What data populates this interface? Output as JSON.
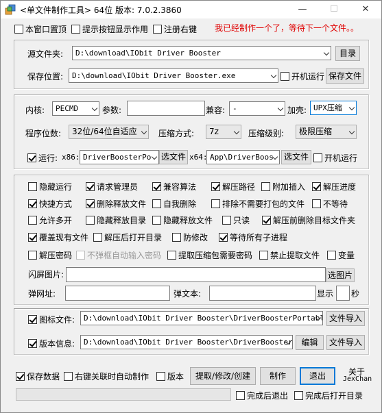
{
  "window": {
    "title": "<单文件制作工具> 64位 版本: 7.0.2.3860",
    "minimize": "—",
    "maximize": "☐",
    "close": "✕"
  },
  "top_options": {
    "pin_top": "本窗口置顶",
    "show_hints": "提示按钮显示作用",
    "register_context": "注册右键",
    "status": "我已经制作一个了，等待下一个文件。。"
  },
  "source": {
    "source_label": "源文件夹:",
    "source_value": "D:\\download\\IObit Driver Booster",
    "dir_button": "目录",
    "save_label": "保存位置:",
    "save_value": "D:\\download\\IObit Driver Booster.exe",
    "autorun_label": "开机运行",
    "save_file_button": "保存文件"
  },
  "engine": {
    "kernel_label": "内核:",
    "kernel_value": "PECMD",
    "param_label": "参数:",
    "param_value": "",
    "compat_label": "兼容:",
    "compat_value": "-",
    "shell_label": "加壳:",
    "shell_value": "UPX压缩",
    "bits_label": "程序位数:",
    "bits_value": "32位/64位自适应",
    "method_label": "压缩方式:",
    "method_value": "7z",
    "level_label": "压缩级别:",
    "level_value": "极限压缩",
    "run_label": "运行:",
    "x86_label": "x86:",
    "x86_value": "DriverBoosterPo",
    "x86_button": "选文件",
    "x64_label": "x64:",
    "x64_value": "App\\DriverBoos",
    "x64_button": "选文件",
    "run_autostart": "开机运行"
  },
  "options": {
    "row1": [
      "隐藏运行",
      "请求管理员",
      "兼容算法",
      "解压路径",
      "附加插入",
      "解压进度"
    ],
    "row2": [
      "快捷方式",
      "删除释放文件",
      "自我删除",
      "排除不需要打包的文件",
      "不等待"
    ],
    "row3": [
      "允许多开",
      "隐藏释放目录",
      "隐藏释放文件",
      "只读",
      "解压前删除目标文件夹"
    ],
    "row4": [
      "覆盖现有文件",
      "解压后打开目录",
      "防修改",
      "等待所有子进程"
    ],
    "row5": [
      "解压密码",
      "不弹框自动输入密码",
      "提取压缩包需要密码",
      "禁止提取文件",
      "变量"
    ],
    "splash_label": "闪屏图片:",
    "splash_value": "",
    "splash_button": "选图片",
    "url_label": "弹网址:",
    "url_value": "",
    "popup_text_label": "弹文本:",
    "popup_text_value": "",
    "show_label": "显示",
    "seconds_value": "",
    "seconds_label": "秒"
  },
  "resources": {
    "icon_label": "图标文件:",
    "icon_value": "D:\\download\\IObit Driver Booster\\DriverBoosterPortable.",
    "icon_button": "文件导入",
    "version_label": "版本信息:",
    "version_value": "D:\\download\\IObit Driver Booster\\DriverBoosterPc",
    "edit_button": "编辑",
    "version_button": "文件导入"
  },
  "bottom": {
    "save_data": "保存数据",
    "auto_make": "右键关联时自动制作",
    "version": "版本",
    "extract_button": "提取/修改/创建",
    "make_button": "制作",
    "exit_button": "退出",
    "about_line1": "关于",
    "about_line2": "JexChan",
    "exit_after": "完成后退出",
    "open_after": "完成后打开目录"
  },
  "colors": {
    "status_text": "#e00000",
    "focus_border": "#0078d7"
  }
}
